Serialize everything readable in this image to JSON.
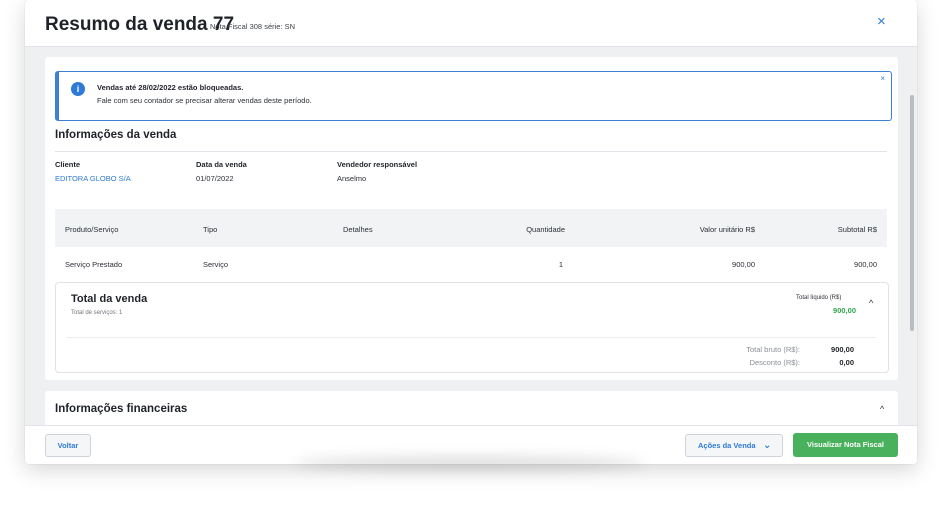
{
  "header": {
    "title": "Resumo da venda 77",
    "subtitle": "Nota Fiscal 308 série: SN",
    "close_icon": "×"
  },
  "alert": {
    "icon": "i",
    "title": "Vendas até 28/02/2022 estão bloqueadas.",
    "text": "Fale com seu contador se precisar alterar vendas deste período.",
    "close": "×"
  },
  "info": {
    "title": "Informações da venda",
    "client_label": "Cliente",
    "client_value": "EDITORA GLOBO S/A",
    "date_label": "Data da venda",
    "date_value": "01/07/2022",
    "seller_label": "Vendedor responsável",
    "seller_value": "Anselmo"
  },
  "table": {
    "headers": [
      "Produto/Serviço",
      "Tipo",
      "Detalhes",
      "Quantidade",
      "Valor unitário R$",
      "Subtotal R$"
    ],
    "rows": [
      [
        "Serviço Prestado",
        "Serviço",
        "",
        "1",
        "900,00",
        "900,00"
      ]
    ]
  },
  "totals": {
    "title": "Total da venda",
    "subtitle": "Total de serviços: 1",
    "net_label": "Total líquido (R$)",
    "net_value": "900,00",
    "gross_label": "Total bruto (R$):",
    "gross_value": "900,00",
    "discount_label": "Desconto (R$):",
    "discount_value": "0,00",
    "chevron": "^"
  },
  "financial": {
    "title": "Informações financeiras",
    "chevron": "^"
  },
  "footer": {
    "back_label": "Voltar",
    "actions_label": "Ações da Venda",
    "actions_chevron": "⌄",
    "view_invoice_label": "Visualizar Nota Fiscal"
  },
  "colors": {
    "accent": "#2e7bd6",
    "success": "#49b05c",
    "net_value": "#2ea64a"
  }
}
